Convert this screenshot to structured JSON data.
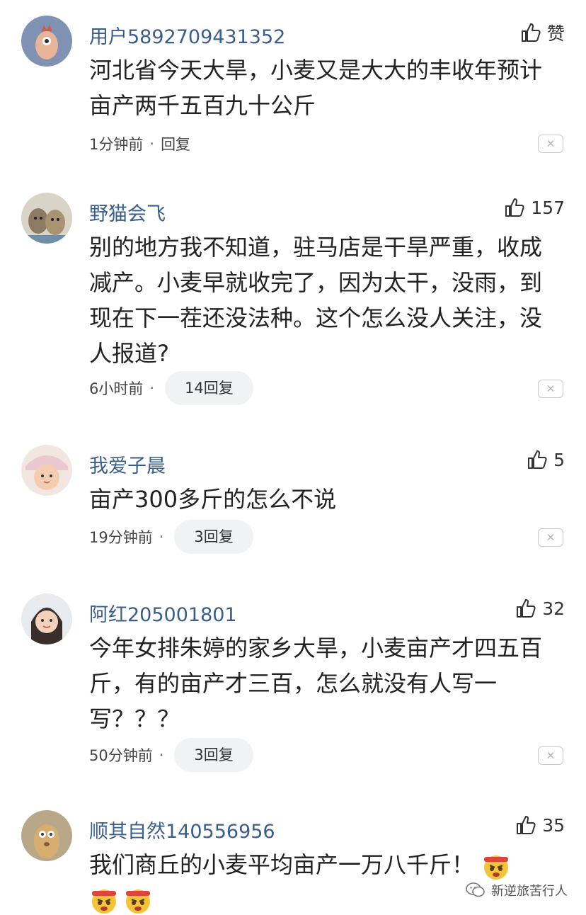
{
  "comments": [
    {
      "username": "用户5892709431352",
      "like_label": "赞",
      "text": "河北省今天大旱，小麦又是大大的丰收年预计亩产两千五百九十公斤",
      "time": "1分钟前",
      "dot": "·",
      "reply_label": "回复",
      "close": "✕"
    },
    {
      "username": "野猫会飞",
      "like_count": "157",
      "text": "别的地方我不知道，驻马店是干旱严重，收成减产。小麦早就收完了，因为太干，没雨，到现在下一茬还没法种。这个怎么没人关注，没人报道?",
      "time": "6小时前",
      "dot": "·",
      "reply_label": "14回复",
      "close": "✕"
    },
    {
      "username": "我爱子晨",
      "like_count": "5",
      "text": "亩产300多斤的怎么不说",
      "time": "19分钟前",
      "dot": "·",
      "reply_label": "3回复",
      "close": "✕"
    },
    {
      "username": "阿红205001801",
      "like_count": "32",
      "text": "今年女排朱婷的家乡大旱，小麦亩产才四五百斤，有的亩产才三百，怎么就没有人写一写？？？",
      "time": "50分钟前",
      "dot": "·",
      "reply_label": "3回复",
      "close": "✕"
    },
    {
      "username": "顺其自然140556956",
      "like_count": "35",
      "text": "我们商丘的小麦平均亩产一万八千斤！",
      "emoji_name": "angry-emoji"
    }
  ],
  "watermark": "新逆旅苦行人",
  "colors": {
    "username": "#3a5e8c",
    "pill_bg": "#f1f2f4",
    "text": "#222222"
  }
}
